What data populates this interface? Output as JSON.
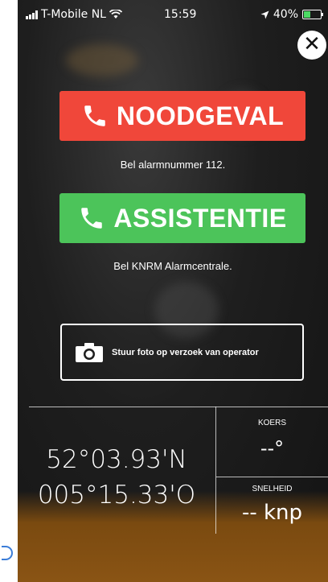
{
  "status_bar": {
    "carrier": "T-Mobile NL",
    "time": "15:59",
    "battery": "40%",
    "battery_level": 0.4,
    "battery_color": "#4cd964"
  },
  "close": {
    "label": "✕",
    "icon": "close-icon"
  },
  "emergency": {
    "label": "NOODGEVAL",
    "icon": "phone-icon",
    "color": "#f0473a",
    "caption": "Bel alarmnummer 112."
  },
  "assistance": {
    "label": "ASSISTENTIE",
    "icon": "phone-icon",
    "color": "#4cc45a",
    "caption": "Bel KNRM Alarmcentrale."
  },
  "photo_button": {
    "label": "Stuur foto op verzoek van operator",
    "icon": "camera-icon"
  },
  "position": {
    "latitude": "52°03.93'N",
    "longitude": "005°15.33'O"
  },
  "heading": {
    "label": "KOERS",
    "value": "--°"
  },
  "speed": {
    "label": "SNELHEID",
    "value": "-- knp"
  }
}
